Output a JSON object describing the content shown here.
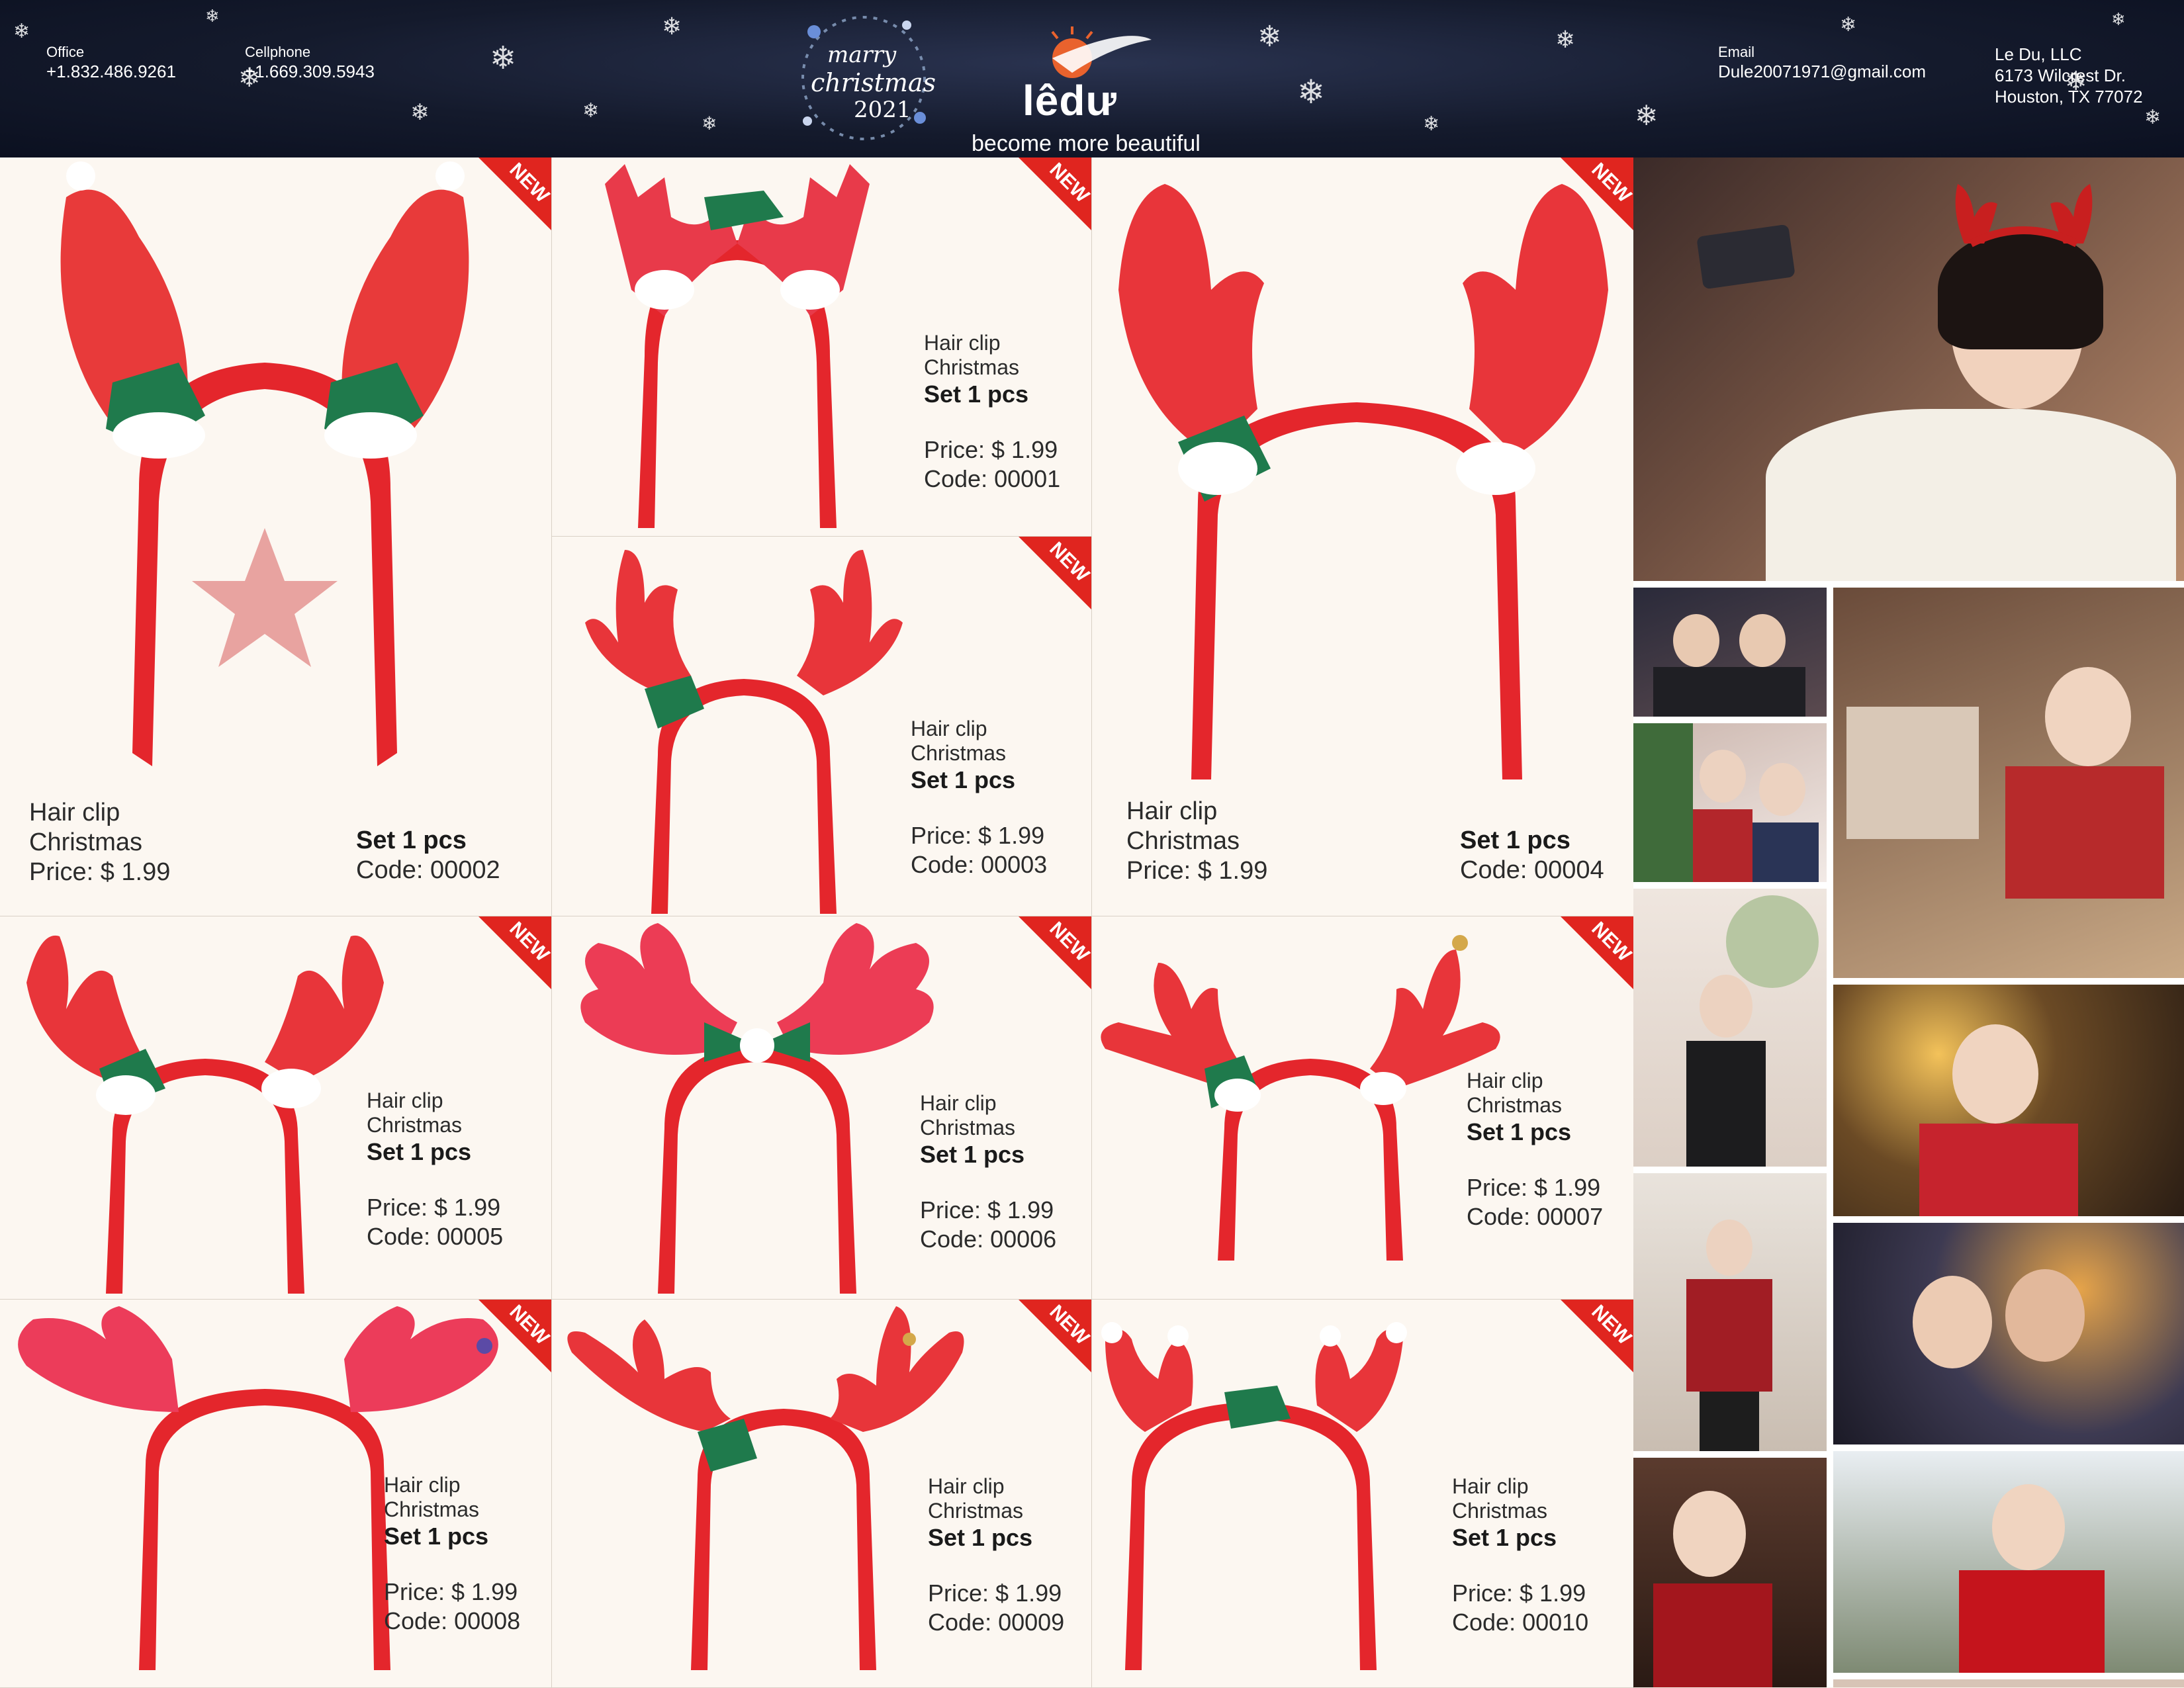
{
  "header": {
    "office_label": "Office",
    "office_phone": "+1.832.486.9261",
    "cell_label": "Cellphone",
    "cell_phone": "+1.669.309.5943",
    "wreath_line1": "marry",
    "wreath_line2": "christmas",
    "wreath_line3": "2021",
    "brand_name": "lêdư",
    "brand_tagline": "become more beautiful",
    "email_label": "Email",
    "email": "Dule20071971@gmail.com",
    "company": "Le Du, LLC",
    "address1": "6173 Wilcrest Dr.",
    "address2": "Houston, TX 77072"
  },
  "badge_text": "NEW",
  "products": [
    {
      "l1": "Hair clip",
      "l2": "Christmas",
      "set": "Set 1 pcs",
      "price": "Price: $ 1.99",
      "code": "Code: 00002"
    },
    {
      "l1": "Hair clip",
      "l2": "Christmas",
      "set": "Set 1 pcs",
      "price": "Price: $ 1.99",
      "code": "Code: 00001"
    },
    {
      "l1": "Hair clip",
      "l2": "Christmas",
      "set": "Set 1 pcs",
      "price": "Price: $ 1.99",
      "code": "Code: 00003"
    },
    {
      "l1": "Hair clip",
      "l2": "Christmas",
      "set": "Set 1 pcs",
      "price": "Price: $ 1.99",
      "code": "Code: 00004"
    },
    {
      "l1": "Hair clip",
      "l2": "Christmas",
      "set": "Set 1 pcs",
      "price": "Price: $ 1.99",
      "code": "Code: 00005"
    },
    {
      "l1": "Hair clip",
      "l2": "Christmas",
      "set": "Set 1 pcs",
      "price": "Price: $ 1.99",
      "code": "Code: 00006"
    },
    {
      "l1": "Hair clip",
      "l2": "Christmas",
      "set": "Set 1 pcs",
      "price": "Price: $ 1.99",
      "code": "Code: 00007"
    },
    {
      "l1": "Hair clip",
      "l2": "Christmas",
      "set": "Set 1 pcs",
      "price": "Price: $ 1.99",
      "code": "Code: 00008"
    },
    {
      "l1": "Hair clip",
      "l2": "Christmas",
      "set": "Set 1 pcs",
      "price": "Price: $ 1.99",
      "code": "Code: 00009"
    },
    {
      "l1": "Hair clip",
      "l2": "Christmas",
      "set": "Set 1 pcs",
      "price": "Price: $ 1.99",
      "code": "Code: 00010"
    }
  ],
  "colors": {
    "header_bg": "#141a2c",
    "headband_red": "#e4262c",
    "badge_red": "#e0251f",
    "holly_green": "#1f7a4c",
    "fur_white": "#ffffff"
  }
}
